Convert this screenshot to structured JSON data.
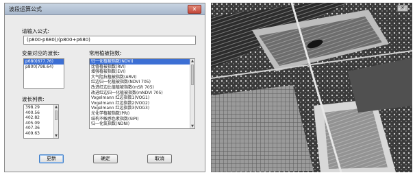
{
  "window": {
    "title": "波段运算公式",
    "close_glyph": "✕"
  },
  "formula": {
    "label": "请输入公式:",
    "value": "(p800-p680)/(p800+p680)"
  },
  "variables": {
    "label": "变量对应的波长:",
    "items": [
      "p680(677.76)",
      "p800(798.64)"
    ],
    "selected_index": 0
  },
  "indices": {
    "label": "常用植被指数:",
    "items": [
      "归一化植被指数(NDVI)",
      "比值植被指数(RVI)",
      "增强植被指数(EVI)",
      "大气阻抗植被指数(ARVI)",
      "红边归一化植被指数(NDVI 705)",
      "改进红边比值植被指数(mSR 705)",
      "改进红边归一化植被指数(mNDVI 705)",
      "Vogelmann 红边指数1(VOG1)",
      "Vogelmann 红边指数2(VOG2)",
      "Vogelmann 红边指数3(VOG3)",
      "光化学植被指数(PRI)",
      "结构不敏感色素指数(SIPI)",
      "归一化氮指数(NDNI)"
    ],
    "selected_index": 0
  },
  "wavelengths": {
    "label": "波长列表:",
    "items": [
      "398.29",
      "400.56",
      "402.82",
      "405.09",
      "407.36",
      "409.63"
    ]
  },
  "buttons": {
    "update": "更新",
    "ok": "确定",
    "cancel": "取消"
  },
  "image_close_glyph": "✕"
}
